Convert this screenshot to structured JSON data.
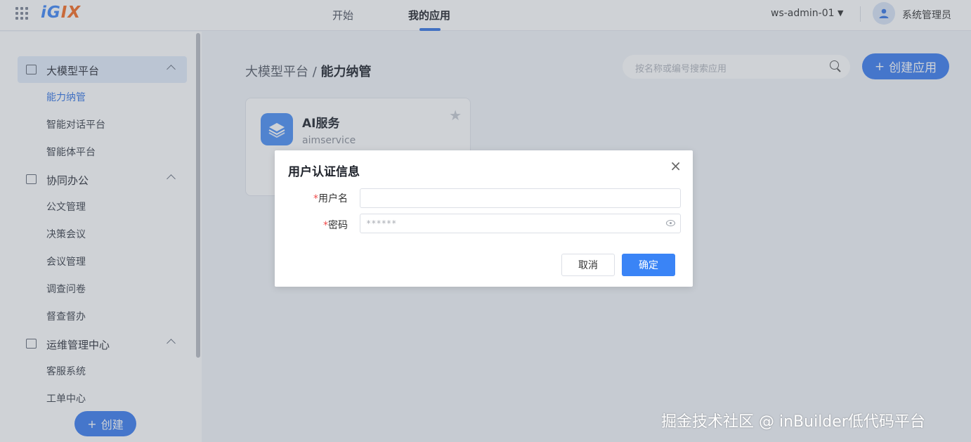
{
  "app": {
    "logo_part1": "iG",
    "logo_part2": "IX"
  },
  "topnav": {
    "tabs": [
      {
        "label": "开始"
      },
      {
        "label": "我的应用"
      }
    ],
    "workspace": "ws-admin-01",
    "user": "系统管理员"
  },
  "sidebar": {
    "groups": [
      {
        "label": "大模型平台",
        "items": [
          "能力纳管",
          "智能对话平台",
          "智能体平台"
        ]
      },
      {
        "label": "协同办公",
        "items": [
          "公文管理",
          "决策会议",
          "会议管理",
          "调查问卷",
          "督查督办"
        ]
      },
      {
        "label": "运维管理中心",
        "items": [
          "客服系统",
          "工单中心"
        ]
      }
    ],
    "create_label": "创建"
  },
  "main": {
    "breadcrumb_parent": "大模型平台",
    "breadcrumb_sep": " / ",
    "breadcrumb_current": "能力纳管",
    "search_placeholder": "按名称或编号搜索应用",
    "create_app_label": "创建应用",
    "card": {
      "title": "AI服务",
      "subtitle": "aimservice"
    }
  },
  "dialog": {
    "title": "用户认证信息",
    "close": "×",
    "username_label": "用户名",
    "password_label": "密码",
    "required_mark": "*",
    "password_value": "******",
    "cancel_label": "取消",
    "ok_label": "确定"
  },
  "watermark": "掘金技术社区 @ inBuilder低代码平台",
  "colors": {
    "primary": "#3a7bf0",
    "active_menu_bg": "#e3ecfb",
    "logo_blue": "#3e86f5",
    "logo_orange": "#f56b22"
  }
}
